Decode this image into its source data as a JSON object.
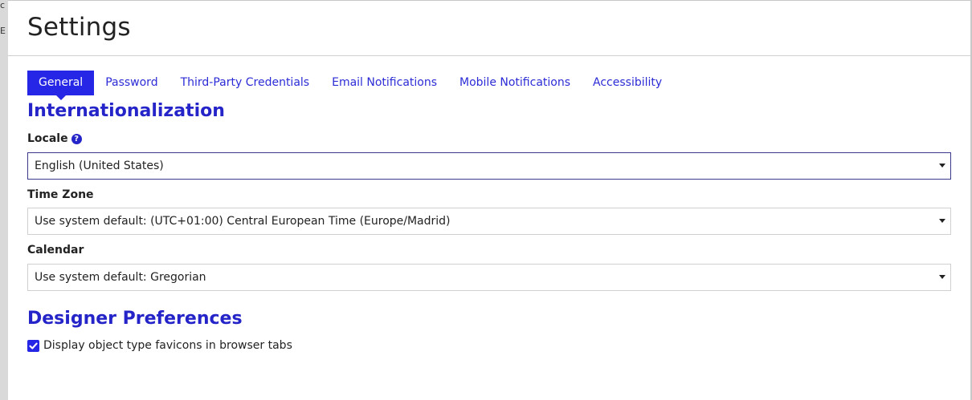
{
  "backdrop": {
    "fragments": [
      "c",
      "E"
    ]
  },
  "dialog": {
    "title": "Settings"
  },
  "tabs": [
    {
      "label": "General",
      "active": true
    },
    {
      "label": "Password",
      "active": false
    },
    {
      "label": "Third-Party Credentials",
      "active": false
    },
    {
      "label": "Email Notifications",
      "active": false
    },
    {
      "label": "Mobile Notifications",
      "active": false
    },
    {
      "label": "Accessibility",
      "active": false
    }
  ],
  "internationalization": {
    "title": "Internationalization",
    "locale": {
      "label": "Locale",
      "value": "English (United States)"
    },
    "time_zone": {
      "label": "Time Zone",
      "value": "Use system default: (UTC+01:00) Central European Time (Europe/Madrid)"
    },
    "calendar": {
      "label": "Calendar",
      "value": "Use system default: Gregorian"
    }
  },
  "designer_preferences": {
    "title": "Designer Preferences",
    "favicons": {
      "label": "Display object type favicons in browser tabs",
      "checked": true
    }
  },
  "colors": {
    "accent": "#2626e6",
    "heading": "#2424c8",
    "tab_text": "#2c2cd6"
  }
}
